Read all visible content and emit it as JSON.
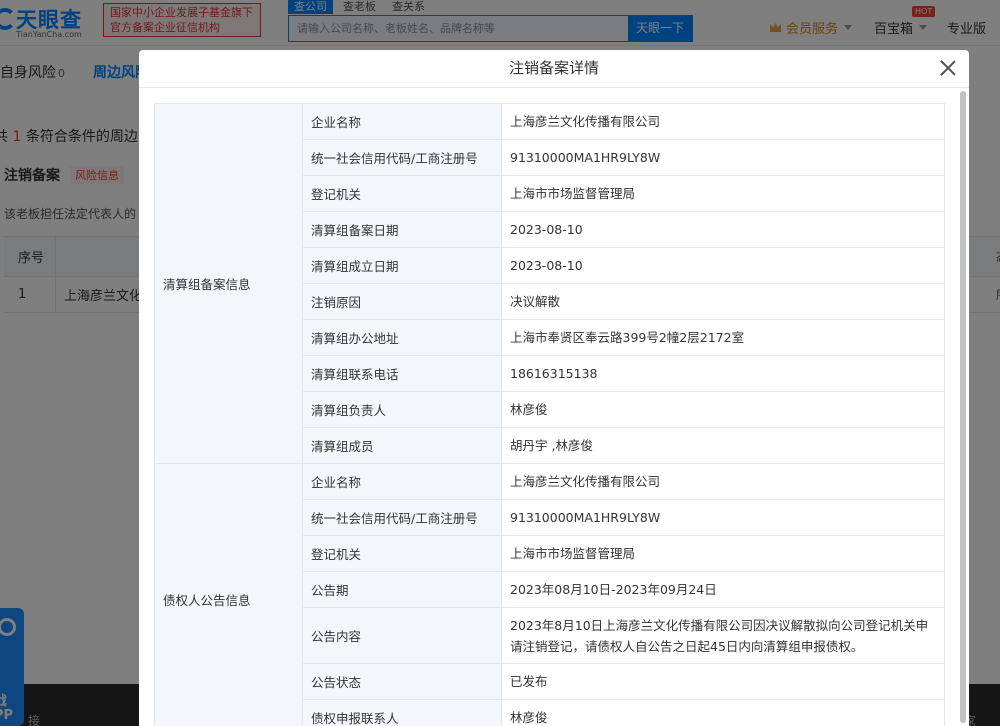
{
  "header": {
    "logo_text": "天眼查",
    "logo_sub": "TianYanCha.com",
    "slogan_line1": "国家中小企业发展子基金旗下",
    "slogan_line2": "官方备案企业征信机构",
    "search_tabs": [
      "查公司",
      "查老板",
      "查关系"
    ],
    "search_placeholder": "请输入公司名称、老板姓名、品牌名称等",
    "search_button": "天眼一下",
    "member_label": "会员服务",
    "treasure_label": "百宝箱",
    "hot_badge": "HOT",
    "pro_label": "专业版"
  },
  "page": {
    "tabs": [
      {
        "label": "自身风险",
        "count": "0"
      },
      {
        "label": "周边风险"
      }
    ],
    "summary_prefix": "共",
    "summary_count": "1",
    "summary_suffix": "条符合条件的周边",
    "section_title": "注销备案",
    "risk_tag": "风险信息",
    "description": "该老板担任法定代表人的",
    "table_headers": [
      "序号"
    ],
    "table_rows": [
      {
        "index": "1",
        "name": "上海彦兰文化"
      }
    ],
    "right_fragment_1": "态",
    "right_fragment_2": "所",
    "footer_left": "接",
    "footer_right": "家",
    "side_widget_text1": "戗",
    "side_widget_text2": "PP"
  },
  "modal": {
    "title": "注销备案详情",
    "sections": [
      {
        "group": "清算组备案信息",
        "rows": [
          {
            "label": "企业名称",
            "value": "上海彦兰文化传播有限公司"
          },
          {
            "label": "统一社会信用代码/工商注册号",
            "value": "91310000MA1HR9LY8W"
          },
          {
            "label": "登记机关",
            "value": "上海市市场监督管理局"
          },
          {
            "label": "清算组备案日期",
            "value": "2023-08-10"
          },
          {
            "label": "清算组成立日期",
            "value": "2023-08-10"
          },
          {
            "label": "注销原因",
            "value": "决议解散"
          },
          {
            "label": "清算组办公地址",
            "value": "上海市奉贤区奉云路399号2幢2层2172室"
          },
          {
            "label": "清算组联系电话",
            "value": "18616315138"
          },
          {
            "label": "清算组负责人",
            "value": "林彦俊"
          },
          {
            "label": "清算组成员",
            "value": "胡丹宇 ,林彦俊"
          }
        ]
      },
      {
        "group": "债权人公告信息",
        "rows": [
          {
            "label": "企业名称",
            "value": "上海彦兰文化传播有限公司"
          },
          {
            "label": "统一社会信用代码/工商注册号",
            "value": "91310000MA1HR9LY8W"
          },
          {
            "label": "登记机关",
            "value": "上海市市场监督管理局"
          },
          {
            "label": "公告期",
            "value": "2023年08月10日-2023年09月24日"
          },
          {
            "label": "公告内容",
            "value": "2023年8月10日上海彦兰文化传播有限公司因决议解散拟向公司登记机关申请注销登记，请债权人自公告之日起45日内向清算组申报债权。"
          },
          {
            "label": "公告状态",
            "value": "已发布"
          },
          {
            "label": "债权申报联系人",
            "value": "林彦俊"
          }
        ]
      }
    ]
  }
}
